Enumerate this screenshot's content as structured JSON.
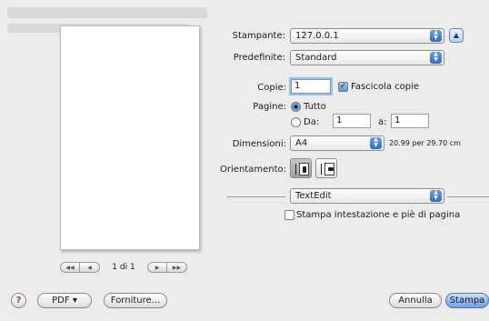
{
  "window": {
    "accent_color": "#4a83d9"
  },
  "preview": {
    "page_count": "1 di 1"
  },
  "form": {
    "printer": {
      "label": "Stampante:",
      "value": "127.0.0.1"
    },
    "presets": {
      "label": "Predefinite:",
      "value": "Standard"
    },
    "copies": {
      "label": "Copie:",
      "value": "1",
      "collate_label": "Fascicola copie",
      "collate_checked": true
    },
    "pages": {
      "label": "Pagine:",
      "all_label": "Tutto",
      "from_label": "Da:",
      "from_value": "1",
      "to_label": "a:",
      "to_value": "1",
      "selected": "all"
    },
    "paper_size": {
      "label": "Dimensioni:",
      "value": "A4",
      "dimensions": "20.99 per 29.70 cm"
    },
    "orientation": {
      "label": "Orientamento:",
      "selected": "portrait"
    },
    "app_section": {
      "value": "TextEdit"
    },
    "header_footer": {
      "label": "Stampa intestazione e piè di pagina",
      "checked": false
    }
  },
  "buttons": {
    "help": "?",
    "pdf": "PDF ▾",
    "supplies": "Forniture...",
    "cancel": "Annulla",
    "print": "Stampa"
  }
}
